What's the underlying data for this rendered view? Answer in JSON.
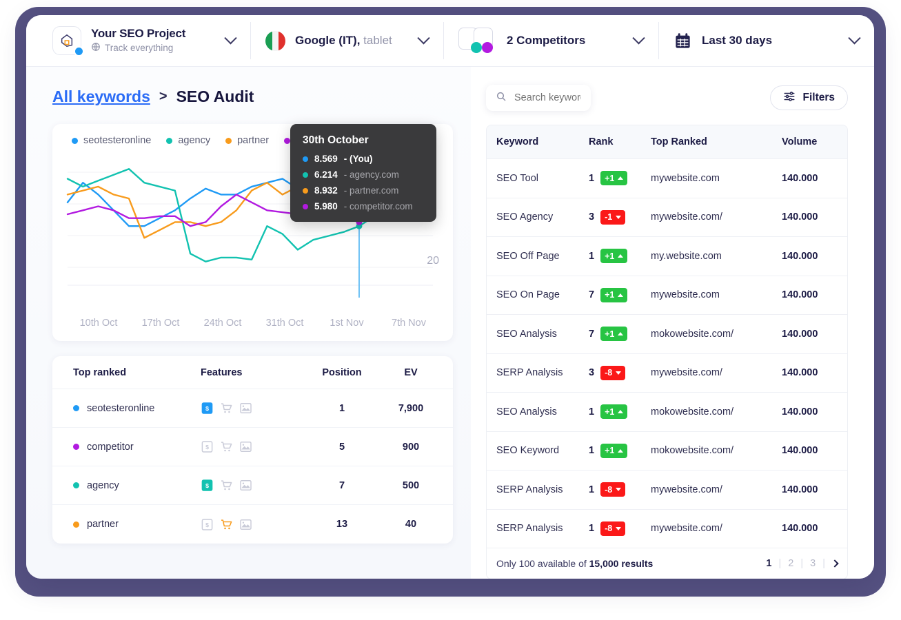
{
  "colors": {
    "frame_purple": "#565282",
    "series_you": "#1f9af5",
    "series_agency": "#12c2b0",
    "series_partner": "#f89b1c",
    "series_competitor": "#b21ae0",
    "badge_up": "#27c443",
    "badge_down": "#fb1818",
    "link_blue": "#2b6cf6"
  },
  "topbar": {
    "project": {
      "title": "Your SEO Project",
      "subtitle": "Track everything",
      "logo_icon": "cube-logo-icon",
      "globe_icon": "globe-icon"
    },
    "engine": {
      "label": "Google (IT),",
      "device": "tablet",
      "flag_icon": "italy-flag-icon"
    },
    "competitors": {
      "label": "2 Competitors",
      "icon": "competitors-icon"
    },
    "daterange": {
      "label": "Last 30 days",
      "icon": "calendar-icon"
    },
    "chevron_icon": "chevron-down-icon"
  },
  "breadcrumb": {
    "link": "All keywords",
    "separator": ">",
    "current": "SEO Audit"
  },
  "chart_data": {
    "type": "line",
    "title": "",
    "xlabel": "",
    "ylabel": "",
    "grid": true,
    "legend_position": "top-left",
    "y_axis_labels": [
      "20"
    ],
    "tick_labels": [
      "10th Oct",
      "17th Oct",
      "24th Oct",
      "31th Oct",
      "1st Nov",
      "7th Nov"
    ],
    "legend": [
      "seotesteronline",
      "agency",
      "partner",
      "competitor"
    ],
    "series": [
      {
        "name": "seotesteronline",
        "color": "#1f9af5",
        "values": [
          62,
          72,
          66,
          58,
          50,
          50,
          54,
          58,
          64,
          69,
          66,
          66,
          70,
          72,
          74,
          69,
          66,
          74,
          78,
          72,
          76,
          74,
          70,
          73
        ]
      },
      {
        "name": "agency",
        "color": "#12c2b0",
        "values": [
          74,
          70,
          73,
          76,
          79,
          72,
          70,
          68,
          36,
          32,
          34,
          34,
          33,
          50,
          46,
          38,
          43,
          45,
          47,
          50,
          55,
          62,
          66,
          70
        ]
      },
      {
        "name": "partner",
        "color": "#f89b1c",
        "values": [
          66,
          68,
          70,
          66,
          64,
          44,
          48,
          52,
          52,
          50,
          52,
          58,
          68,
          72,
          66,
          70,
          72,
          70,
          66,
          62,
          60,
          66,
          70,
          72
        ]
      },
      {
        "name": "competitor",
        "color": "#b21ae0",
        "values": [
          56,
          58,
          60,
          58,
          54,
          54,
          55,
          55,
          50,
          52,
          60,
          66,
          62,
          58,
          57,
          56,
          55,
          57,
          57,
          52,
          56,
          54,
          57,
          55
        ]
      }
    ],
    "marker": {
      "date": "30th October",
      "series": "seotesteronline"
    }
  },
  "tooltip": {
    "title": "30th October",
    "rows": [
      {
        "value": "8.569",
        "sep": "-",
        "site": "(You)",
        "color": "#1f9af5",
        "bold_site": true
      },
      {
        "value": "6.214",
        "sep": "-",
        "site": "agency.com",
        "color": "#12c2b0",
        "bold_site": false
      },
      {
        "value": "8.932",
        "sep": "-",
        "site": "partner.com",
        "color": "#f89b1c",
        "bold_site": false
      },
      {
        "value": "5.980",
        "sep": "-",
        "site": "competitor.com",
        "color": "#b21ae0",
        "bold_site": false
      }
    ]
  },
  "top_ranked": {
    "headers": [
      "Top ranked",
      "Features",
      "Position",
      "EV"
    ],
    "rows": [
      {
        "name": "seotesteronline",
        "color": "#1f9af5",
        "features": {
          "ads": true,
          "shopping": false,
          "images": false
        },
        "position": "1",
        "ev": "7,900"
      },
      {
        "name": "competitor",
        "color": "#b21ae0",
        "features": {
          "ads": false,
          "shopping": false,
          "images": false
        },
        "position": "5",
        "ev": "900"
      },
      {
        "name": "agency",
        "color": "#12c2b0",
        "features": {
          "ads": true,
          "shopping": false,
          "images": false
        },
        "position": "7",
        "ev": "500"
      },
      {
        "name": "partner",
        "color": "#f89b1c",
        "features": {
          "ads": false,
          "shopping": true,
          "images": false
        },
        "position": "13",
        "ev": "40"
      }
    ],
    "feature_icons": [
      "ads-dollar-icon",
      "shopping-cart-icon",
      "image-results-icon"
    ]
  },
  "search": {
    "placeholder": "Search keywords",
    "value": "",
    "icon": "search-icon"
  },
  "filters": {
    "label": "Filters",
    "icon": "filters-sliders-icon"
  },
  "keywords_table": {
    "headers": [
      "Keyword",
      "Rank",
      "Top Ranked",
      "Volume"
    ],
    "rows": [
      {
        "keyword": "SEO Tool",
        "rank": "1",
        "delta": "+1",
        "dir": "up",
        "top_ranked": "mywebsite.com",
        "volume": "140.000"
      },
      {
        "keyword": "SEO Agency",
        "rank": "3",
        "delta": "-1",
        "dir": "down",
        "top_ranked": "mywebsite.com/",
        "volume": "140.000"
      },
      {
        "keyword": "SEO Off Page",
        "rank": "1",
        "delta": "+1",
        "dir": "up",
        "top_ranked": "my.website.com",
        "volume": "140.000"
      },
      {
        "keyword": "SEO On Page",
        "rank": "7",
        "delta": "+1",
        "dir": "up",
        "top_ranked": "mywebsite.com",
        "volume": "140.000"
      },
      {
        "keyword": "SEO Analysis",
        "rank": "7",
        "delta": "+1",
        "dir": "up",
        "top_ranked": "mokowebsite.com/",
        "volume": "140.000"
      },
      {
        "keyword": "SERP Analysis",
        "rank": "3",
        "delta": "-8",
        "dir": "down",
        "top_ranked": "mywebsite.com/",
        "volume": "140.000"
      },
      {
        "keyword": "SEO Analysis",
        "rank": "1",
        "delta": "+1",
        "dir": "up",
        "top_ranked": "mokowebsite.com/",
        "volume": "140.000"
      },
      {
        "keyword": "SEO Keyword",
        "rank": "1",
        "delta": "+1",
        "dir": "up",
        "top_ranked": "mokowebsite.com/",
        "volume": "140.000"
      },
      {
        "keyword": "SERP Analysis",
        "rank": "1",
        "delta": "-8",
        "dir": "down",
        "top_ranked": "mywebsite.com/",
        "volume": "140.000"
      },
      {
        "keyword": "SERP Analysis",
        "rank": "1",
        "delta": "-8",
        "dir": "down",
        "top_ranked": "mywebsite.com/",
        "volume": "140.000"
      }
    ],
    "footer": {
      "text_prefix": "Only 100 available of ",
      "text_bold": "15,000 results",
      "pages": [
        "1",
        "2",
        "3"
      ],
      "next_icon": "chevron-right-icon"
    }
  }
}
